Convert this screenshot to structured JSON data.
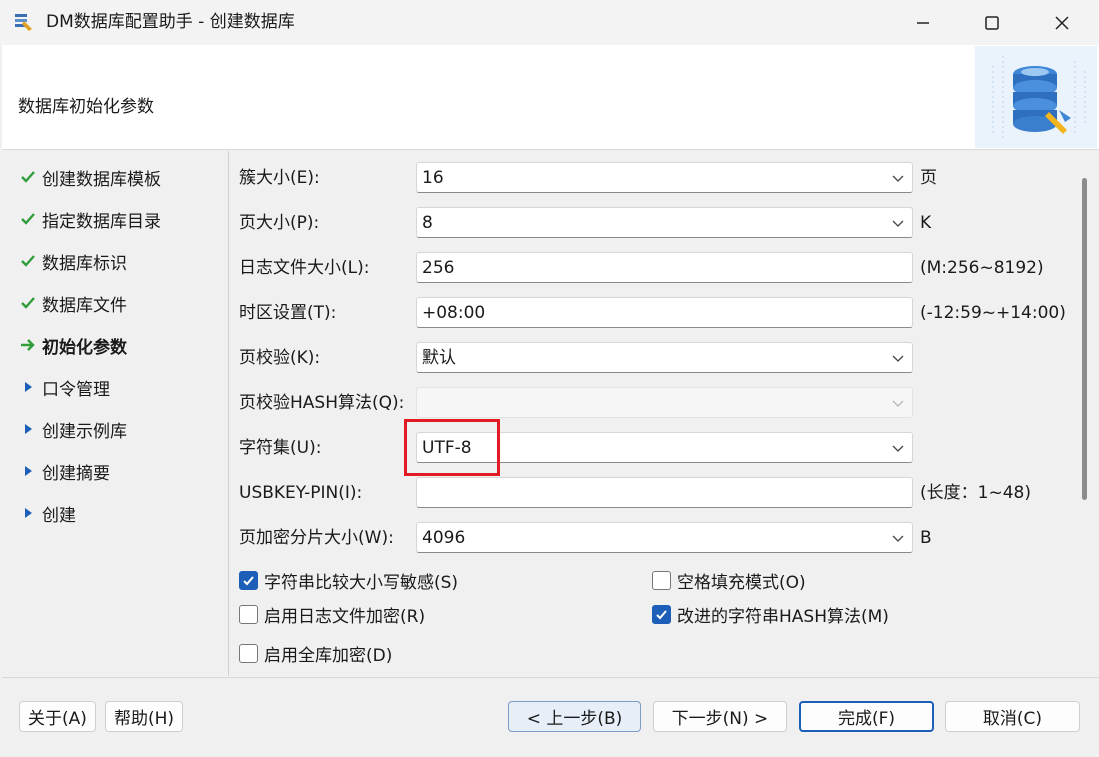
{
  "window": {
    "title": "DM数据库配置助手 - 创建数据库",
    "minimize": "—",
    "maximize": "☐",
    "close": "✕"
  },
  "header": {
    "title": "数据库初始化参数"
  },
  "steps": [
    {
      "label": "创建数据库模板",
      "state": "done"
    },
    {
      "label": "指定数据库目录",
      "state": "done"
    },
    {
      "label": "数据库标识",
      "state": "done"
    },
    {
      "label": "数据库文件",
      "state": "done"
    },
    {
      "label": "初始化参数",
      "state": "current"
    },
    {
      "label": "口令管理",
      "state": "pending"
    },
    {
      "label": "创建示例库",
      "state": "pending"
    },
    {
      "label": "创建摘要",
      "state": "pending"
    },
    {
      "label": "创建",
      "state": "pending"
    }
  ],
  "params": {
    "extent_size": {
      "label": "簇大小(E):",
      "value": "16",
      "suffix": "页"
    },
    "page_size": {
      "label": "页大小(P):",
      "value": "8",
      "suffix": "K"
    },
    "log_size": {
      "label": "日志文件大小(L):",
      "value": "256",
      "suffix": "(M:256~8192)"
    },
    "time_zone": {
      "label": "时区设置(T):",
      "value": "+08:00",
      "suffix": "(-12:59~+14:00)"
    },
    "page_check": {
      "label": "页校验(K):",
      "value": "默认"
    },
    "page_check_hash": {
      "label": "页校验HASH算法(Q):",
      "value": ""
    },
    "charset": {
      "label": "字符集(U):",
      "value": "UTF-8"
    },
    "usbkey_pin": {
      "label": "USBKEY-PIN(I):",
      "value": "",
      "suffix": "(长度：1~48)"
    },
    "encrypt_slice": {
      "label": "页加密分片大小(W):",
      "value": "4096",
      "suffix": "B"
    }
  },
  "options": {
    "case_sensitive": {
      "label": "字符串比较大小写敏感(S)",
      "checked": true
    },
    "blank_pad": {
      "label": "空格填充模式(O)",
      "checked": false
    },
    "log_encrypt": {
      "label": "启用日志文件加密(R)",
      "checked": false
    },
    "improved_hash": {
      "label": "改进的字符串HASH算法(M)",
      "checked": true
    },
    "full_encrypt": {
      "label": "启用全库加密(D)",
      "checked": false
    }
  },
  "footer": {
    "about": "关于(A)",
    "help": "帮助(H)",
    "prev": "< 上一步(B)",
    "next": "下一步(N) >",
    "finish": "完成(F)",
    "cancel": "取消(C)"
  },
  "colors": {
    "accent": "#1d5fb8",
    "highlight": "#e01b24",
    "check": "#2e9d3a"
  }
}
